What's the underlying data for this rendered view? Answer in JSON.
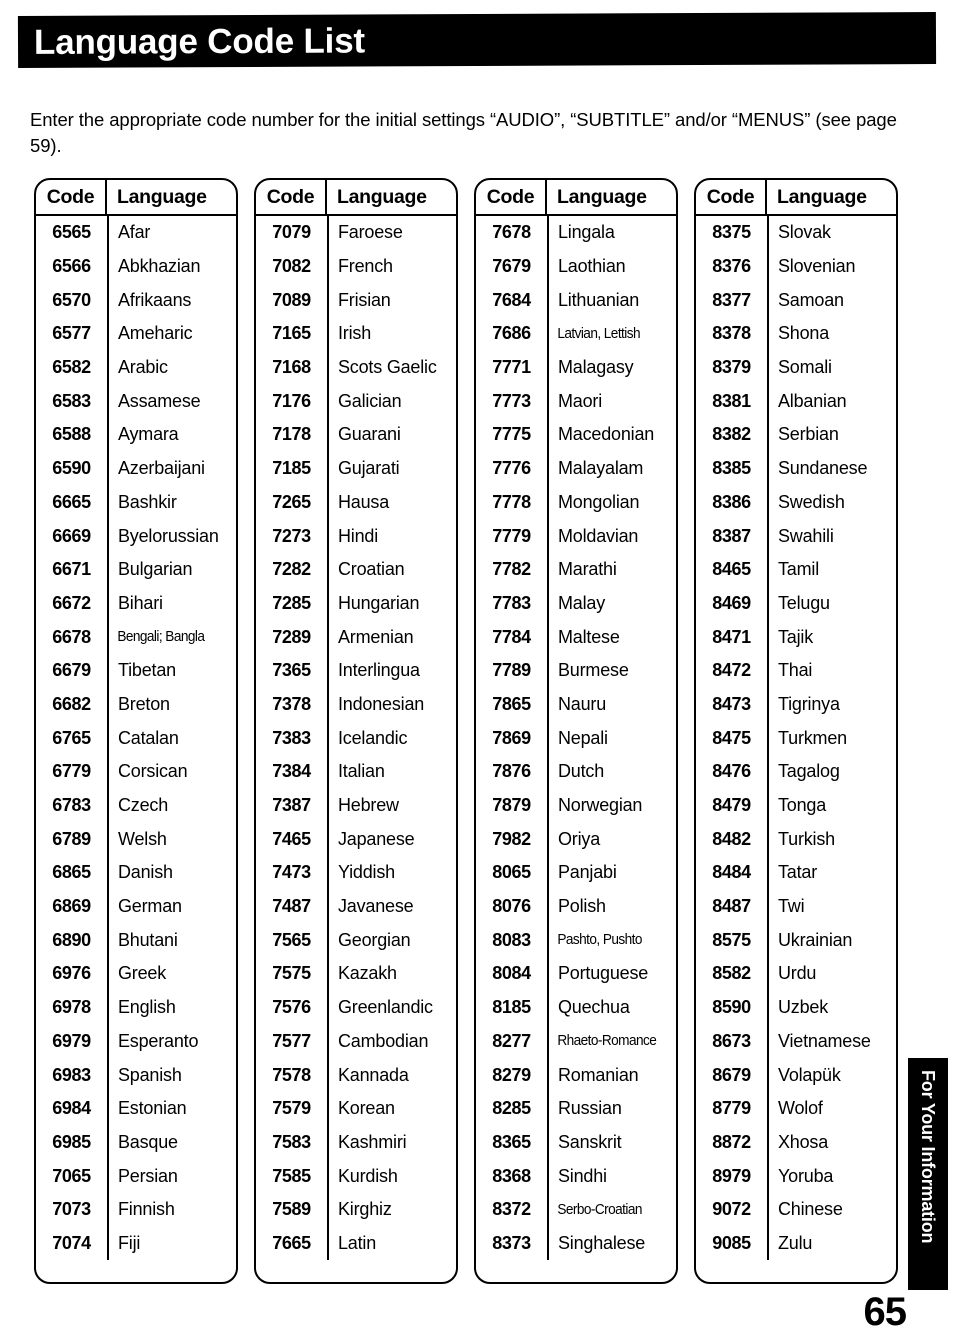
{
  "header": {
    "title": "Language Code List"
  },
  "intro": {
    "text": "Enter the appropriate code number for the initial settings “AUDIO”, “SUBTITLE” and/or “MENUS” (see page 59)."
  },
  "table_headers": {
    "code": "Code",
    "language": "Language"
  },
  "side_tab": {
    "label": "For Your Information"
  },
  "page": {
    "number": "65"
  },
  "columns": [
    {
      "rows": [
        {
          "code": "6565",
          "language": "Afar"
        },
        {
          "code": "6566",
          "language": "Abkhazian"
        },
        {
          "code": "6570",
          "language": "Afrikaans"
        },
        {
          "code": "6577",
          "language": "Ameharic"
        },
        {
          "code": "6582",
          "language": "Arabic"
        },
        {
          "code": "6583",
          "language": "Assamese"
        },
        {
          "code": "6588",
          "language": "Aymara"
        },
        {
          "code": "6590",
          "language": "Azerbaijani"
        },
        {
          "code": "6665",
          "language": "Bashkir"
        },
        {
          "code": "6669",
          "language": "Byelorussian"
        },
        {
          "code": "6671",
          "language": "Bulgarian"
        },
        {
          "code": "6672",
          "language": "Bihari"
        },
        {
          "code": "6678",
          "language": "Bengali; Bangla"
        },
        {
          "code": "6679",
          "language": "Tibetan"
        },
        {
          "code": "6682",
          "language": "Breton"
        },
        {
          "code": "6765",
          "language": "Catalan"
        },
        {
          "code": "6779",
          "language": "Corsican"
        },
        {
          "code": "6783",
          "language": "Czech"
        },
        {
          "code": "6789",
          "language": "Welsh"
        },
        {
          "code": "6865",
          "language": "Danish"
        },
        {
          "code": "6869",
          "language": "German"
        },
        {
          "code": "6890",
          "language": "Bhutani"
        },
        {
          "code": "6976",
          "language": "Greek"
        },
        {
          "code": "6978",
          "language": "English"
        },
        {
          "code": "6979",
          "language": "Esperanto"
        },
        {
          "code": "6983",
          "language": "Spanish"
        },
        {
          "code": "6984",
          "language": "Estonian"
        },
        {
          "code": "6985",
          "language": "Basque"
        },
        {
          "code": "7065",
          "language": "Persian"
        },
        {
          "code": "7073",
          "language": "Finnish"
        },
        {
          "code": "7074",
          "language": "Fiji"
        }
      ]
    },
    {
      "rows": [
        {
          "code": "7079",
          "language": "Faroese"
        },
        {
          "code": "7082",
          "language": "French"
        },
        {
          "code": "7089",
          "language": "Frisian"
        },
        {
          "code": "7165",
          "language": "Irish"
        },
        {
          "code": "7168",
          "language": "Scots Gaelic"
        },
        {
          "code": "7176",
          "language": "Galician"
        },
        {
          "code": "7178",
          "language": "Guarani"
        },
        {
          "code": "7185",
          "language": "Gujarati"
        },
        {
          "code": "7265",
          "language": "Hausa"
        },
        {
          "code": "7273",
          "language": "Hindi"
        },
        {
          "code": "7282",
          "language": "Croatian"
        },
        {
          "code": "7285",
          "language": "Hungarian"
        },
        {
          "code": "7289",
          "language": "Armenian"
        },
        {
          "code": "7365",
          "language": "Interlingua"
        },
        {
          "code": "7378",
          "language": "Indonesian"
        },
        {
          "code": "7383",
          "language": "Icelandic"
        },
        {
          "code": "7384",
          "language": "Italian"
        },
        {
          "code": "7387",
          "language": "Hebrew"
        },
        {
          "code": "7465",
          "language": "Japanese"
        },
        {
          "code": "7473",
          "language": "Yiddish"
        },
        {
          "code": "7487",
          "language": "Javanese"
        },
        {
          "code": "7565",
          "language": "Georgian"
        },
        {
          "code": "7575",
          "language": "Kazakh"
        },
        {
          "code": "7576",
          "language": "Greenlandic"
        },
        {
          "code": "7577",
          "language": "Cambodian"
        },
        {
          "code": "7578",
          "language": "Kannada"
        },
        {
          "code": "7579",
          "language": "Korean"
        },
        {
          "code": "7583",
          "language": "Kashmiri"
        },
        {
          "code": "7585",
          "language": "Kurdish"
        },
        {
          "code": "7589",
          "language": "Kirghiz"
        },
        {
          "code": "7665",
          "language": "Latin"
        }
      ]
    },
    {
      "rows": [
        {
          "code": "7678",
          "language": "Lingala"
        },
        {
          "code": "7679",
          "language": "Laothian"
        },
        {
          "code": "7684",
          "language": "Lithuanian"
        },
        {
          "code": "7686",
          "language": "Latvian, Lettish"
        },
        {
          "code": "7771",
          "language": "Malagasy"
        },
        {
          "code": "7773",
          "language": "Maori"
        },
        {
          "code": "7775",
          "language": "Macedonian"
        },
        {
          "code": "7776",
          "language": "Malayalam"
        },
        {
          "code": "7778",
          "language": "Mongolian"
        },
        {
          "code": "7779",
          "language": "Moldavian"
        },
        {
          "code": "7782",
          "language": "Marathi"
        },
        {
          "code": "7783",
          "language": "Malay"
        },
        {
          "code": "7784",
          "language": "Maltese"
        },
        {
          "code": "7789",
          "language": "Burmese"
        },
        {
          "code": "7865",
          "language": "Nauru"
        },
        {
          "code": "7869",
          "language": "Nepali"
        },
        {
          "code": "7876",
          "language": "Dutch"
        },
        {
          "code": "7879",
          "language": "Norwegian"
        },
        {
          "code": "7982",
          "language": "Oriya"
        },
        {
          "code": "8065",
          "language": "Panjabi"
        },
        {
          "code": "8076",
          "language": "Polish"
        },
        {
          "code": "8083",
          "language": "Pashto, Pushto"
        },
        {
          "code": "8084",
          "language": "Portuguese"
        },
        {
          "code": "8185",
          "language": "Quechua"
        },
        {
          "code": "8277",
          "language": "Rhaeto-Romance"
        },
        {
          "code": "8279",
          "language": "Romanian"
        },
        {
          "code": "8285",
          "language": "Russian"
        },
        {
          "code": "8365",
          "language": "Sanskrit"
        },
        {
          "code": "8368",
          "language": "Sindhi"
        },
        {
          "code": "8372",
          "language": "Serbo-Croatian"
        },
        {
          "code": "8373",
          "language": "Singhalese"
        }
      ]
    },
    {
      "rows": [
        {
          "code": "8375",
          "language": "Slovak"
        },
        {
          "code": "8376",
          "language": "Slovenian"
        },
        {
          "code": "8377",
          "language": "Samoan"
        },
        {
          "code": "8378",
          "language": "Shona"
        },
        {
          "code": "8379",
          "language": "Somali"
        },
        {
          "code": "8381",
          "language": "Albanian"
        },
        {
          "code": "8382",
          "language": "Serbian"
        },
        {
          "code": "8385",
          "language": "Sundanese"
        },
        {
          "code": "8386",
          "language": "Swedish"
        },
        {
          "code": "8387",
          "language": "Swahili"
        },
        {
          "code": "8465",
          "language": "Tamil"
        },
        {
          "code": "8469",
          "language": "Telugu"
        },
        {
          "code": "8471",
          "language": "Tajik"
        },
        {
          "code": "8472",
          "language": "Thai"
        },
        {
          "code": "8473",
          "language": "Tigrinya"
        },
        {
          "code": "8475",
          "language": "Turkmen"
        },
        {
          "code": "8476",
          "language": "Tagalog"
        },
        {
          "code": "8479",
          "language": "Tonga"
        },
        {
          "code": "8482",
          "language": "Turkish"
        },
        {
          "code": "8484",
          "language": "Tatar"
        },
        {
          "code": "8487",
          "language": "Twi"
        },
        {
          "code": "8575",
          "language": "Ukrainian"
        },
        {
          "code": "8582",
          "language": "Urdu"
        },
        {
          "code": "8590",
          "language": "Uzbek"
        },
        {
          "code": "8673",
          "language": "Vietnamese"
        },
        {
          "code": "8679",
          "language": "Volapük"
        },
        {
          "code": "8779",
          "language": "Wolof"
        },
        {
          "code": "8872",
          "language": "Xhosa"
        },
        {
          "code": "8979",
          "language": "Yoruba"
        },
        {
          "code": "9072",
          "language": "Chinese"
        },
        {
          "code": "9085",
          "language": "Zulu"
        }
      ]
    }
  ]
}
